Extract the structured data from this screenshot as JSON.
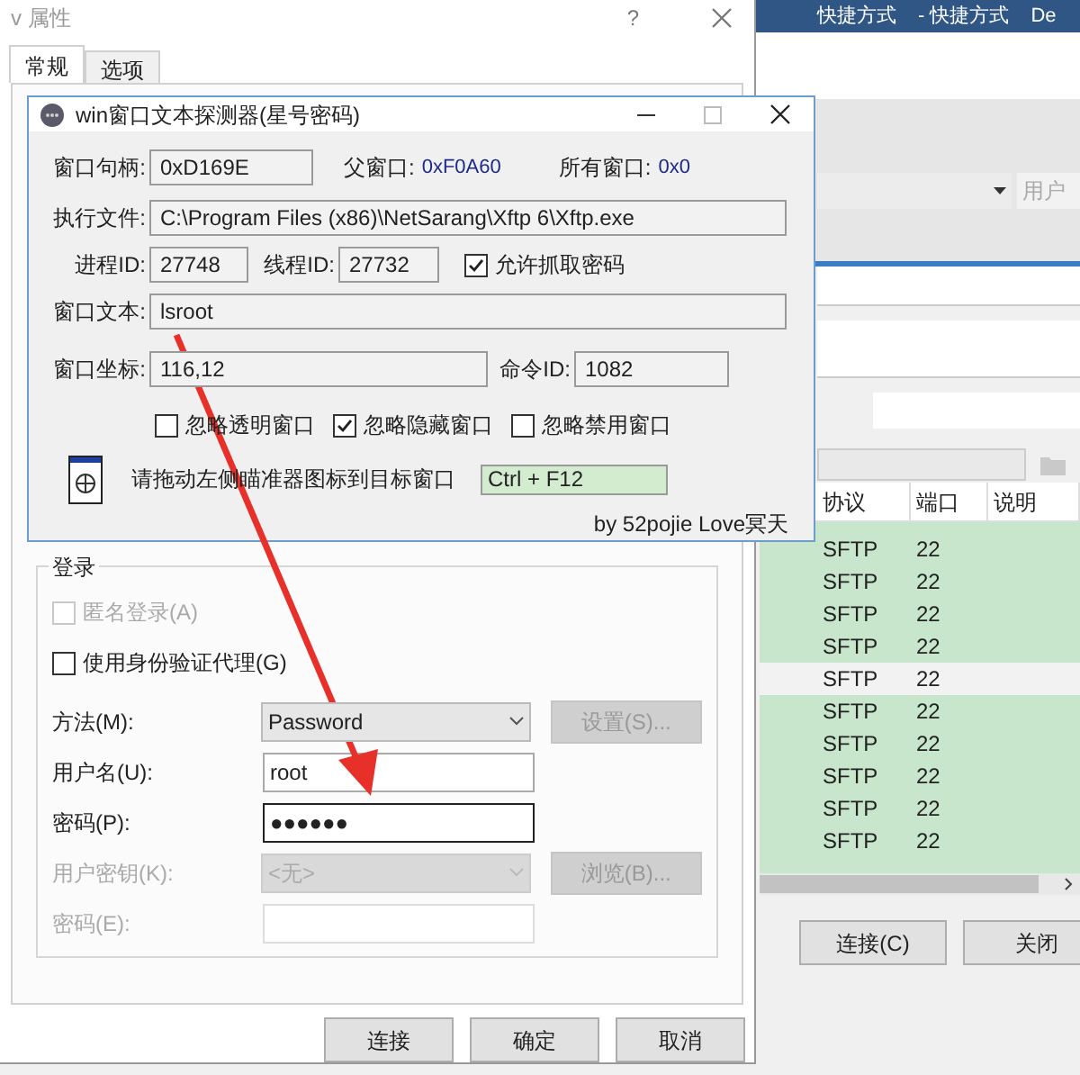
{
  "desktop": {
    "shortcuts": [
      "快捷方式",
      "- 快捷方式",
      "De"
    ]
  },
  "session_window": {
    "user_field": "用户",
    "table": {
      "columns": [
        "协议",
        "端口",
        "说明"
      ],
      "rows": [
        {
          "protocol": "SFTP",
          "port": "22",
          "selected": true
        },
        {
          "protocol": "SFTP",
          "port": "22",
          "selected": true
        },
        {
          "protocol": "SFTP",
          "port": "22",
          "selected": true
        },
        {
          "protocol": "SFTP",
          "port": "22",
          "selected": true
        },
        {
          "protocol": "SFTP",
          "port": "22",
          "selected": false
        },
        {
          "protocol": "SFTP",
          "port": "22",
          "selected": true
        },
        {
          "protocol": "SFTP",
          "port": "22",
          "selected": true
        },
        {
          "protocol": "SFTP",
          "port": "22",
          "selected": true
        },
        {
          "protocol": "SFTP",
          "port": "22",
          "selected": true
        },
        {
          "protocol": "SFTP",
          "port": "22",
          "selected": true
        }
      ]
    },
    "buttons": [
      "连接(C)",
      "关闭"
    ]
  },
  "properties_dialog": {
    "title": "v 属性",
    "help": "?",
    "tabs": [
      {
        "label": "常规",
        "selected": true
      },
      {
        "label": "选项",
        "selected": false
      }
    ],
    "login_group": {
      "title": "登录",
      "checkboxes": [
        {
          "label": "匿名登录(A)",
          "checked": false,
          "disabled": true
        },
        {
          "label": "使用身份验证代理(G)",
          "checked": false,
          "disabled": false
        }
      ],
      "fields": [
        {
          "kind": "select",
          "label": "方法(M):",
          "value": "Password",
          "disabled": false,
          "button": {
            "label": "设置(S)...",
            "disabled": true
          }
        },
        {
          "kind": "input",
          "label": "用户名(U):",
          "value": "root",
          "disabled": false,
          "focused": false
        },
        {
          "kind": "input",
          "label": "密码(P):",
          "value": "●●●●●●",
          "disabled": false,
          "focused": true
        },
        {
          "kind": "select",
          "label": "用户密钥(K):",
          "value": "<无>",
          "disabled": true,
          "button": {
            "label": "浏览(B)...",
            "disabled": true
          }
        },
        {
          "kind": "input",
          "label": "密码(E):",
          "disabled": true,
          "focused": false
        }
      ]
    },
    "buttons": [
      "连接",
      "确定",
      "取消"
    ]
  },
  "probe_window": {
    "title": "win窗口文本探测器(星号密码)",
    "handle": {
      "label": "窗口句柄:",
      "value": "0xD169E"
    },
    "parent": {
      "label": "父窗口:",
      "value": "0xF0A60"
    },
    "owner": {
      "label": "所有窗口:",
      "value": "0x0"
    },
    "executable": {
      "label": "执行文件:",
      "value": "C:\\Program Files (x86)\\NetSarang\\Xftp 6\\Xftp.exe"
    },
    "process_id": {
      "label": "进程ID:",
      "value": "27748"
    },
    "thread_id": {
      "label": "线程ID:",
      "value": "27732"
    },
    "allow_password": {
      "label": "允许抓取密码",
      "checked": true
    },
    "window_text": {
      "label": "窗口文本:",
      "value": "lsroot"
    },
    "coords": {
      "label": "窗口坐标:",
      "value": "116,12"
    },
    "command_id": {
      "label": "命令ID:",
      "value": "1082"
    },
    "filters": [
      {
        "label": "忽略透明窗口",
        "checked": false
      },
      {
        "label": "忽略隐藏窗口",
        "checked": true
      },
      {
        "label": "忽略禁用窗口",
        "checked": false
      }
    ],
    "hint": "请拖动左侧瞄准器图标到目标窗口",
    "hotkey": "Ctrl + F12",
    "credit": "by 52pojie Love冥天"
  }
}
